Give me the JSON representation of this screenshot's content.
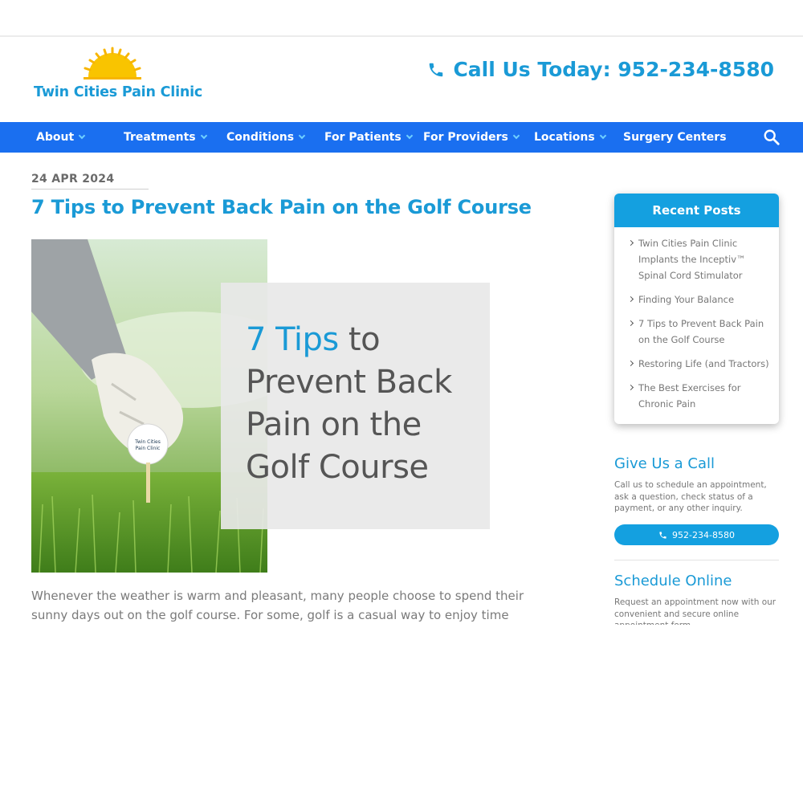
{
  "brand": {
    "name": "Twin Cities Pain Clinic",
    "primary_color": "#1a9ad6",
    "nav_color": "#1a6ff0",
    "sun_colors": [
      "#f7b500",
      "#f9d000"
    ]
  },
  "header": {
    "call_label": "Call Us Today: 952-234-8580",
    "icon": "phone-icon"
  },
  "nav": {
    "items": [
      {
        "label": "About",
        "has_dropdown": true
      },
      {
        "label": "Treatments",
        "has_dropdown": true
      },
      {
        "label": "Conditions",
        "has_dropdown": true
      },
      {
        "label": "For Patients",
        "has_dropdown": true
      },
      {
        "label": "For Providers",
        "has_dropdown": true
      },
      {
        "label": "Locations",
        "has_dropdown": true
      },
      {
        "label": "Surgery Centers",
        "has_dropdown": false
      }
    ],
    "search_icon": "search-icon"
  },
  "post": {
    "date": "24  APR 2024",
    "title": "7 Tips to Prevent Back Pain on the Golf Course",
    "image_overlay": {
      "accent": "7 Tips",
      "line1_rest": " to",
      "line2": "Prevent Back",
      "line3": "Pain on the",
      "line4": "Golf Course"
    },
    "golf_ball_text": "Twin Cities Pain Clinic",
    "body_line1": "Whenever the weather is warm and pleasant, many people choose to spend their",
    "body_line2": "sunny days out on the golf course. For some, golf is a casual way to enjoy time with"
  },
  "sidebar": {
    "recent_posts": {
      "title": "Recent Posts",
      "items": [
        "Twin Cities Pain Clinic Implants the Inceptiv™ Spinal Cord Stimulator",
        "Finding Your Balance",
        "7 Tips to Prevent Back Pain on the Golf Course",
        "Restoring Life (and Tractors)",
        "The Best Exercises for Chronic Pain"
      ]
    },
    "give_call": {
      "title": "Give Us a Call",
      "text": "Call us to schedule an appointment, ask a question, check status of a payment, or any other inquiry.",
      "button_label": "952-234-8580"
    },
    "schedule": {
      "title": "Schedule Online",
      "text": "Request an appointment now with our convenient and secure online appointment form."
    }
  }
}
